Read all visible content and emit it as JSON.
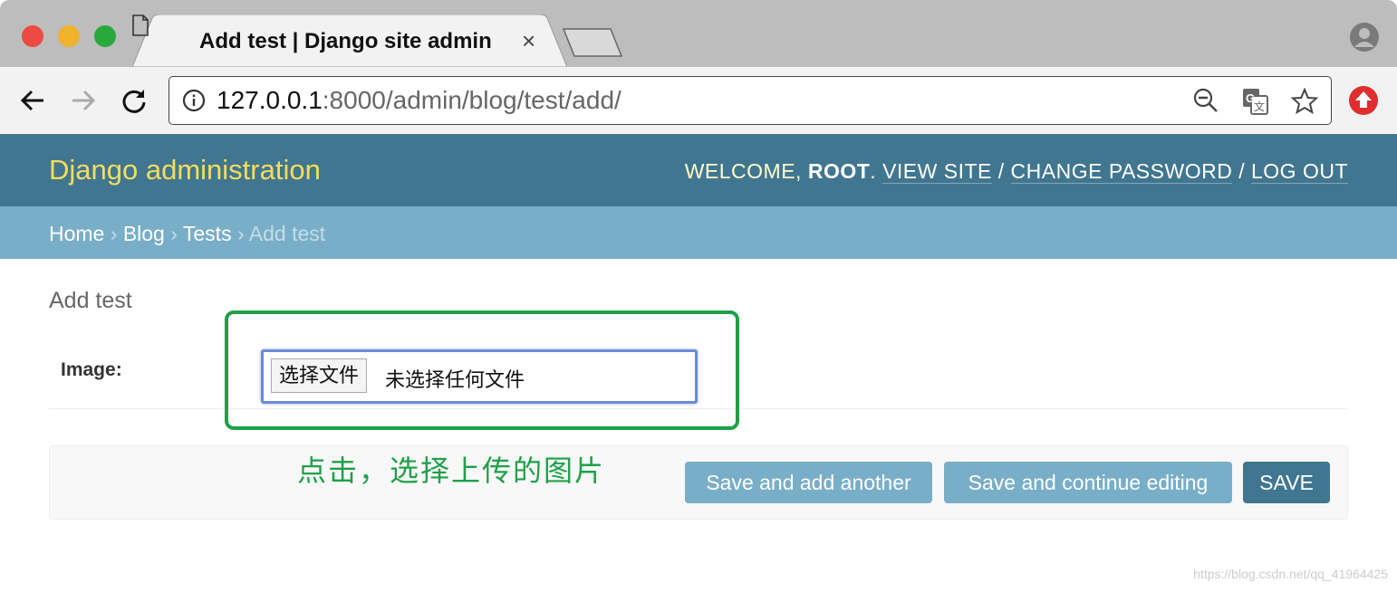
{
  "browser": {
    "tab_title": "Add test | Django site admin",
    "tab_close": "×",
    "url_host": "127.0.0.1",
    "url_rest": ":8000/admin/blog/test/add/"
  },
  "header": {
    "brand": "Django administration",
    "welcome": "WELCOME, ",
    "username": "ROOT",
    "period": ". ",
    "view_site": "VIEW SITE",
    "sep": " / ",
    "change_password": "CHANGE PASSWORD",
    "log_out": "LOG OUT"
  },
  "breadcrumbs": {
    "home": "Home",
    "blog": "Blog",
    "tests": "Tests",
    "current": "Add test",
    "arrow": " › "
  },
  "form": {
    "title": "Add test",
    "image_label": "Image:",
    "file_button": "选择文件",
    "file_status": "未选择任何文件"
  },
  "annotation": "点击，选择上传的图片",
  "buttons": {
    "save_add_another": "Save and add another",
    "save_continue": "Save and continue editing",
    "save": "SAVE"
  },
  "watermark": "https://blog.csdn.net/qq_41964425",
  "colors": {
    "header_bg": "#417690",
    "breadcrumb_bg": "#79aec8",
    "brand": "#f5dd5d",
    "highlight": "#1fa048"
  }
}
